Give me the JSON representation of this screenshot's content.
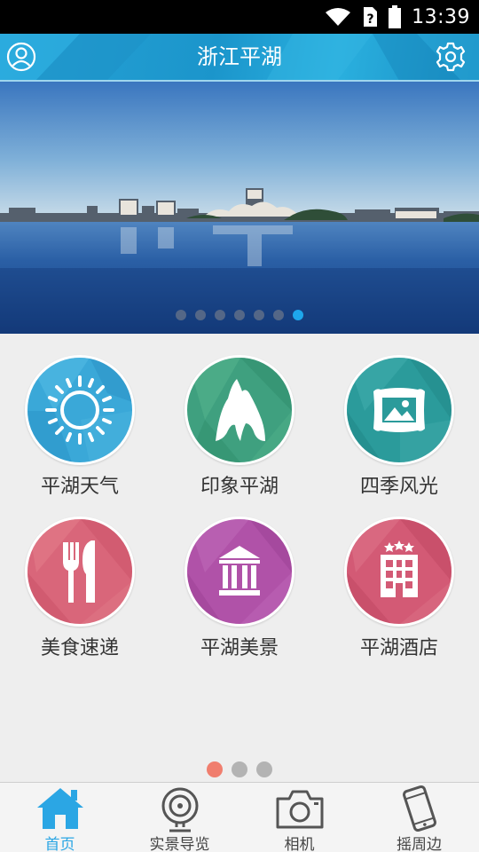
{
  "status_bar": {
    "time": "13:39"
  },
  "header": {
    "title": "浙江平湖"
  },
  "banner": {
    "page_count": 7,
    "active_page": 7
  },
  "grid": {
    "items": [
      {
        "label": "平湖天气",
        "icon": "sun-icon",
        "color": "#3aa8d8"
      },
      {
        "label": "印象平湖",
        "icon": "mountain-icon",
        "color": "#3fa07f"
      },
      {
        "label": "四季风光",
        "icon": "picture-frame-icon",
        "color": "#2b9b9b"
      },
      {
        "label": "美食速递",
        "icon": "fork-knife-icon",
        "color": "#d9667a"
      },
      {
        "label": "平湖美景",
        "icon": "museum-icon",
        "color": "#b052a8"
      },
      {
        "label": "平湖酒店",
        "icon": "hotel-icon",
        "color": "#d35a75"
      }
    ],
    "page_count": 3,
    "active_page": 1
  },
  "bottom_nav": {
    "items": [
      {
        "label": "首页",
        "icon": "home-icon",
        "active": true
      },
      {
        "label": "实景导览",
        "icon": "webcam-icon",
        "active": false
      },
      {
        "label": "相机",
        "icon": "camera-icon",
        "active": false
      },
      {
        "label": "摇周边",
        "icon": "phone-shake-icon",
        "active": false
      }
    ]
  },
  "colors": {
    "header": "#1f9bd0",
    "accent": "#2ba6e4",
    "pager_active": "#f07e6e"
  }
}
